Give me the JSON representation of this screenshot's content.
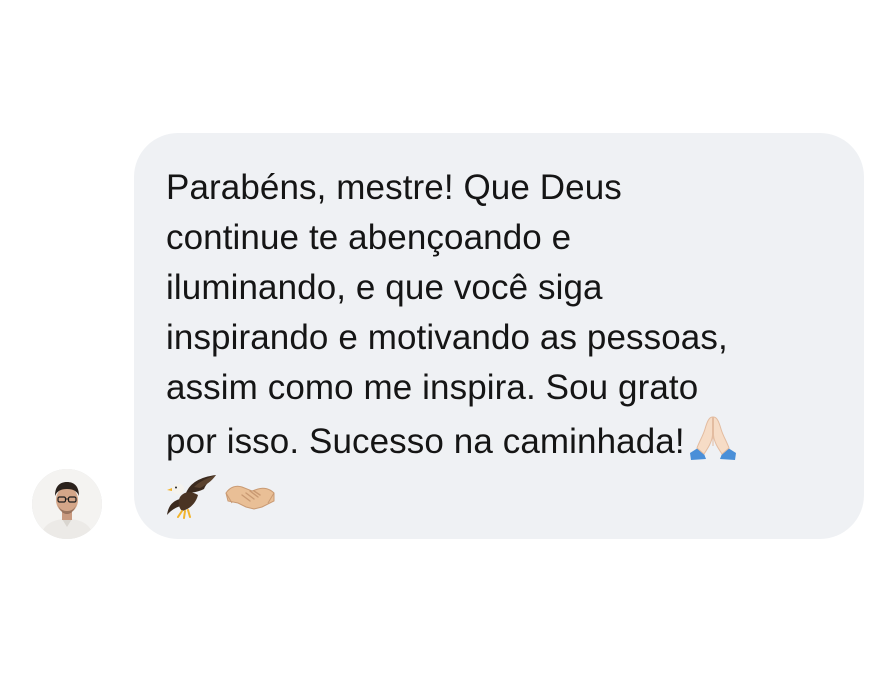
{
  "message": {
    "line_1": "Parabéns, mestre! Que Deus",
    "line_2": "continue te abençoando e",
    "line_3": "iluminando, e que você siga",
    "line_4": "inspirando e motivando as pessoas,",
    "line_5": "assim como me inspira. Sou grato",
    "line_6": "por isso. Sucesso na caminhada!",
    "emojis": [
      "folded-hands-icon",
      "eagle-icon",
      "handshake-icon"
    ]
  },
  "colors": {
    "bubble": "#eff1f4",
    "text": "#151515",
    "background": "#ffffff"
  }
}
